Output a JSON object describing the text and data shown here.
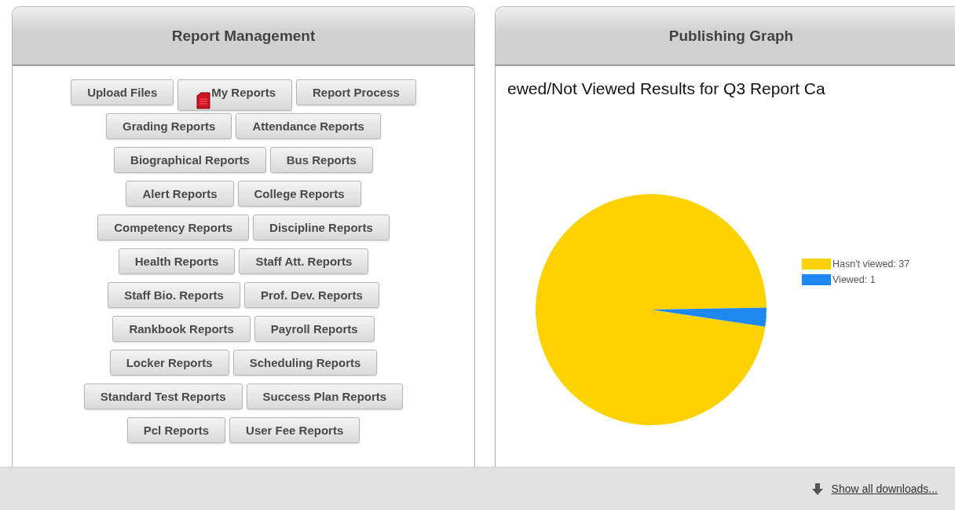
{
  "report_management": {
    "title": "Report Management",
    "button_rows": [
      [
        {
          "label": "Upload Files",
          "kind": "plain"
        },
        {
          "label": "My Reports",
          "kind": "with-icon"
        },
        {
          "label": "Report Process",
          "kind": "plain"
        }
      ],
      [
        {
          "label": "Grading Reports",
          "kind": "plain"
        },
        {
          "label": "Attendance Reports",
          "kind": "plain"
        }
      ],
      [
        {
          "label": "Biographical Reports",
          "kind": "plain"
        },
        {
          "label": "Bus Reports",
          "kind": "plain"
        }
      ],
      [
        {
          "label": "Alert Reports",
          "kind": "plain"
        },
        {
          "label": "College Reports",
          "kind": "plain"
        }
      ],
      [
        {
          "label": "Competency Reports",
          "kind": "plain"
        },
        {
          "label": "Discipline Reports",
          "kind": "plain"
        }
      ],
      [
        {
          "label": "Health Reports",
          "kind": "plain"
        },
        {
          "label": "Staff Att. Reports",
          "kind": "plain"
        }
      ],
      [
        {
          "label": "Staff Bio. Reports",
          "kind": "plain"
        },
        {
          "label": "Prof. Dev. Reports",
          "kind": "plain"
        }
      ],
      [
        {
          "label": "Rankbook Reports",
          "kind": "plain"
        },
        {
          "label": "Payroll Reports",
          "kind": "plain"
        }
      ],
      [
        {
          "label": "Locker Reports",
          "kind": "plain"
        },
        {
          "label": "Scheduling Reports",
          "kind": "plain"
        }
      ],
      [
        {
          "label": "Standard Test Reports",
          "kind": "plain"
        },
        {
          "label": "Success Plan Reports",
          "kind": "plain"
        }
      ],
      [
        {
          "label": "Pcl Reports",
          "kind": "plain"
        },
        {
          "label": "User Fee Reports",
          "kind": "plain"
        }
      ]
    ]
  },
  "publishing_graph": {
    "title": "Publishing Graph",
    "chart_data": {
      "type": "pie",
      "title": "ewed/Not Viewed Results for Q3 Report Ca",
      "categories": [
        "Hasn't viewed: 37",
        "Viewed: 1"
      ],
      "values": [
        37,
        1
      ],
      "legend": "right",
      "colors": [
        "#fcd200",
        "#1e88f0"
      ]
    }
  },
  "download_bar": {
    "link": "Show all downloads..."
  }
}
